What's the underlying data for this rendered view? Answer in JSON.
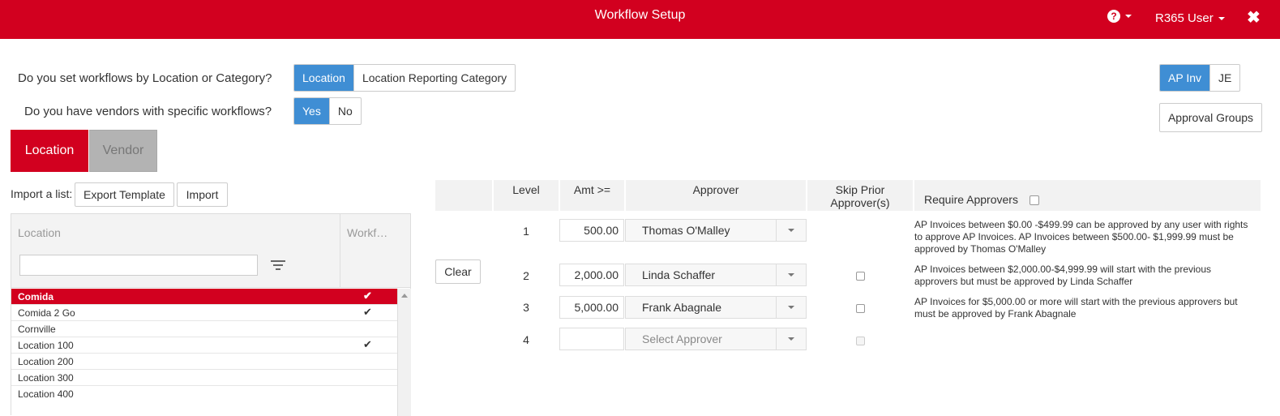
{
  "header": {
    "title": "Workflow Setup",
    "user": "R365 User",
    "help_glyph": "?",
    "close_glyph": "✖",
    "brand_color": "#d2001f"
  },
  "questions": {
    "workflow_by": {
      "label": "Do you set workflows by Location or Category?",
      "options": [
        "Location",
        "Location Reporting Category"
      ],
      "selected": "Location"
    },
    "vendor_specific": {
      "label": "Do you have vendors with specific workflows?",
      "options": [
        "Yes",
        "No"
      ],
      "selected": "Yes"
    }
  },
  "doc_type_toggle": {
    "options": [
      "AP Inv",
      "JE"
    ],
    "selected": "AP Inv"
  },
  "approval_groups_label": "Approval Groups",
  "tabs": {
    "location": "Location",
    "vendor": "Vendor",
    "active": "Location"
  },
  "import": {
    "label": "Import a list:",
    "export_template": "Export Template",
    "import_button": "Import"
  },
  "grid": {
    "columns": [
      "Location",
      "Workf…"
    ],
    "filter_value": "",
    "rows": [
      {
        "name": "Comida",
        "has_workflow": true,
        "selected": true
      },
      {
        "name": "Comida 2 Go",
        "has_workflow": true,
        "selected": false
      },
      {
        "name": "Cornville",
        "has_workflow": false,
        "selected": false
      },
      {
        "name": "Location 100",
        "has_workflow": true,
        "selected": false
      },
      {
        "name": "Location 200",
        "has_workflow": false,
        "selected": false
      },
      {
        "name": "Location 300",
        "has_workflow": false,
        "selected": false
      },
      {
        "name": "Location 400",
        "has_workflow": false,
        "selected": false
      }
    ],
    "check_glyph": "✔"
  },
  "approvals": {
    "headers": {
      "level": "Level",
      "amount": "Amt >=",
      "approver": "Approver",
      "skip_prior_1": "Skip Prior",
      "skip_prior_2": "Approver(s)",
      "require": "Require Approvers"
    },
    "clear_label": "Clear",
    "rows": [
      {
        "level": "1",
        "amount": "500.00",
        "approver": "Thomas O'Malley",
        "skip_prior": null,
        "desc": "AP Invoices between $0.00 -$499.99 can be approved by any user with rights to approve AP Invoices. AP Invoices between $500.00- $1,999.99 must be approved by Thomas O'Malley"
      },
      {
        "level": "2",
        "amount": "2,000.00",
        "approver": "Linda Schaffer",
        "skip_prior": false,
        "desc": "AP Invoices between $2,000.00-$4,999.99 will start with the previous approvers but must be approved by Linda Schaffer"
      },
      {
        "level": "3",
        "amount": "5,000.00",
        "approver": "Frank Abagnale",
        "skip_prior": false,
        "desc": "AP Invoices for $5,000.00 or more will start with the previous approvers but must be approved by Frank Abagnale"
      },
      {
        "level": "4",
        "amount": "",
        "approver": "Select Approver",
        "skip_prior": false,
        "desc": ""
      }
    ]
  }
}
